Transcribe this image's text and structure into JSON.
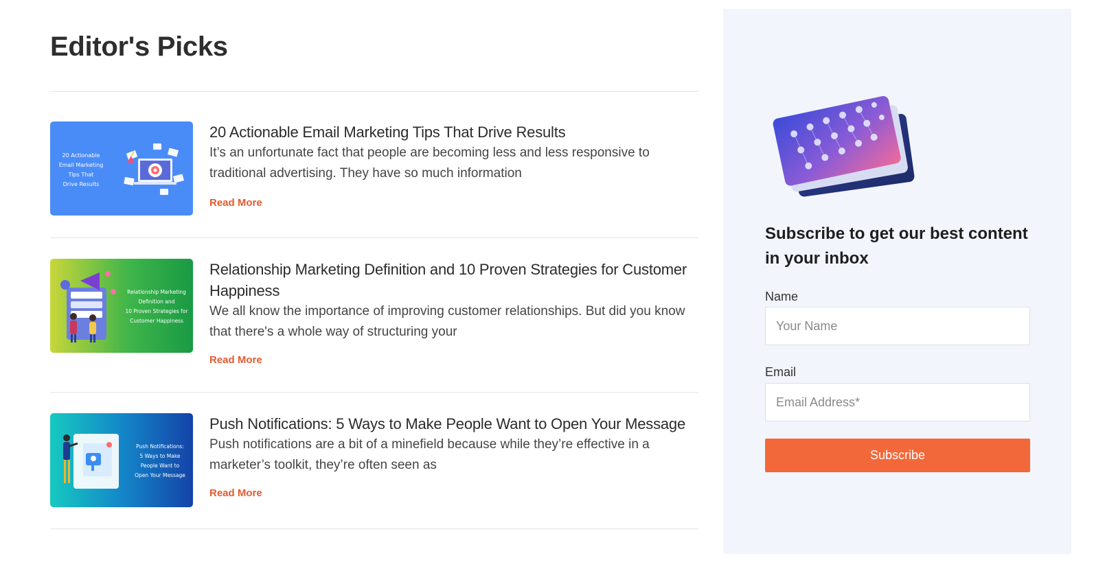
{
  "section": {
    "title": "Editor's Picks"
  },
  "posts": [
    {
      "title": "20 Actionable Email Marketing Tips That Drive Results",
      "excerpt": "It’s an unfortunate fact that people are becoming less and less responsive to traditional advertising. They have so much information",
      "read_more": "Read More",
      "thumbnail_caption": [
        "20 Actionable",
        "Email Marketing",
        "Tips That",
        "Drive Results"
      ]
    },
    {
      "title": "Relationship Marketing Definition and 10 Proven Strategies for Customer Happiness",
      "excerpt": "We all know the importance of improving customer relationships. But did you know that there's a whole way of structuring your",
      "read_more": "Read More",
      "thumbnail_caption": [
        "Relationship Marketing",
        "Definition and",
        "10 Proven Strategies for",
        "Customer Happiness"
      ]
    },
    {
      "title": "Push Notifications: 5 Ways to Make People Want to Open Your Message",
      "excerpt": "Push notifications are a bit of a minefield because while they’re effective in a marketer’s toolkit, they’re often seen as",
      "read_more": "Read More",
      "thumbnail_caption": [
        "Push Notifications:",
        "5 Ways to Make",
        "People Want to",
        "Open Your Message"
      ]
    }
  ],
  "subscribe": {
    "heading": "Subscribe to get our best content in your inbox",
    "name_label": "Name",
    "name_placeholder": "Your Name",
    "email_label": "Email",
    "email_placeholder": "Email Address*",
    "button_label": "Subscribe"
  },
  "colors": {
    "accent": "#e35a2f",
    "button": "#f2683a",
    "sidebar_bg": "#f2f5fb"
  }
}
